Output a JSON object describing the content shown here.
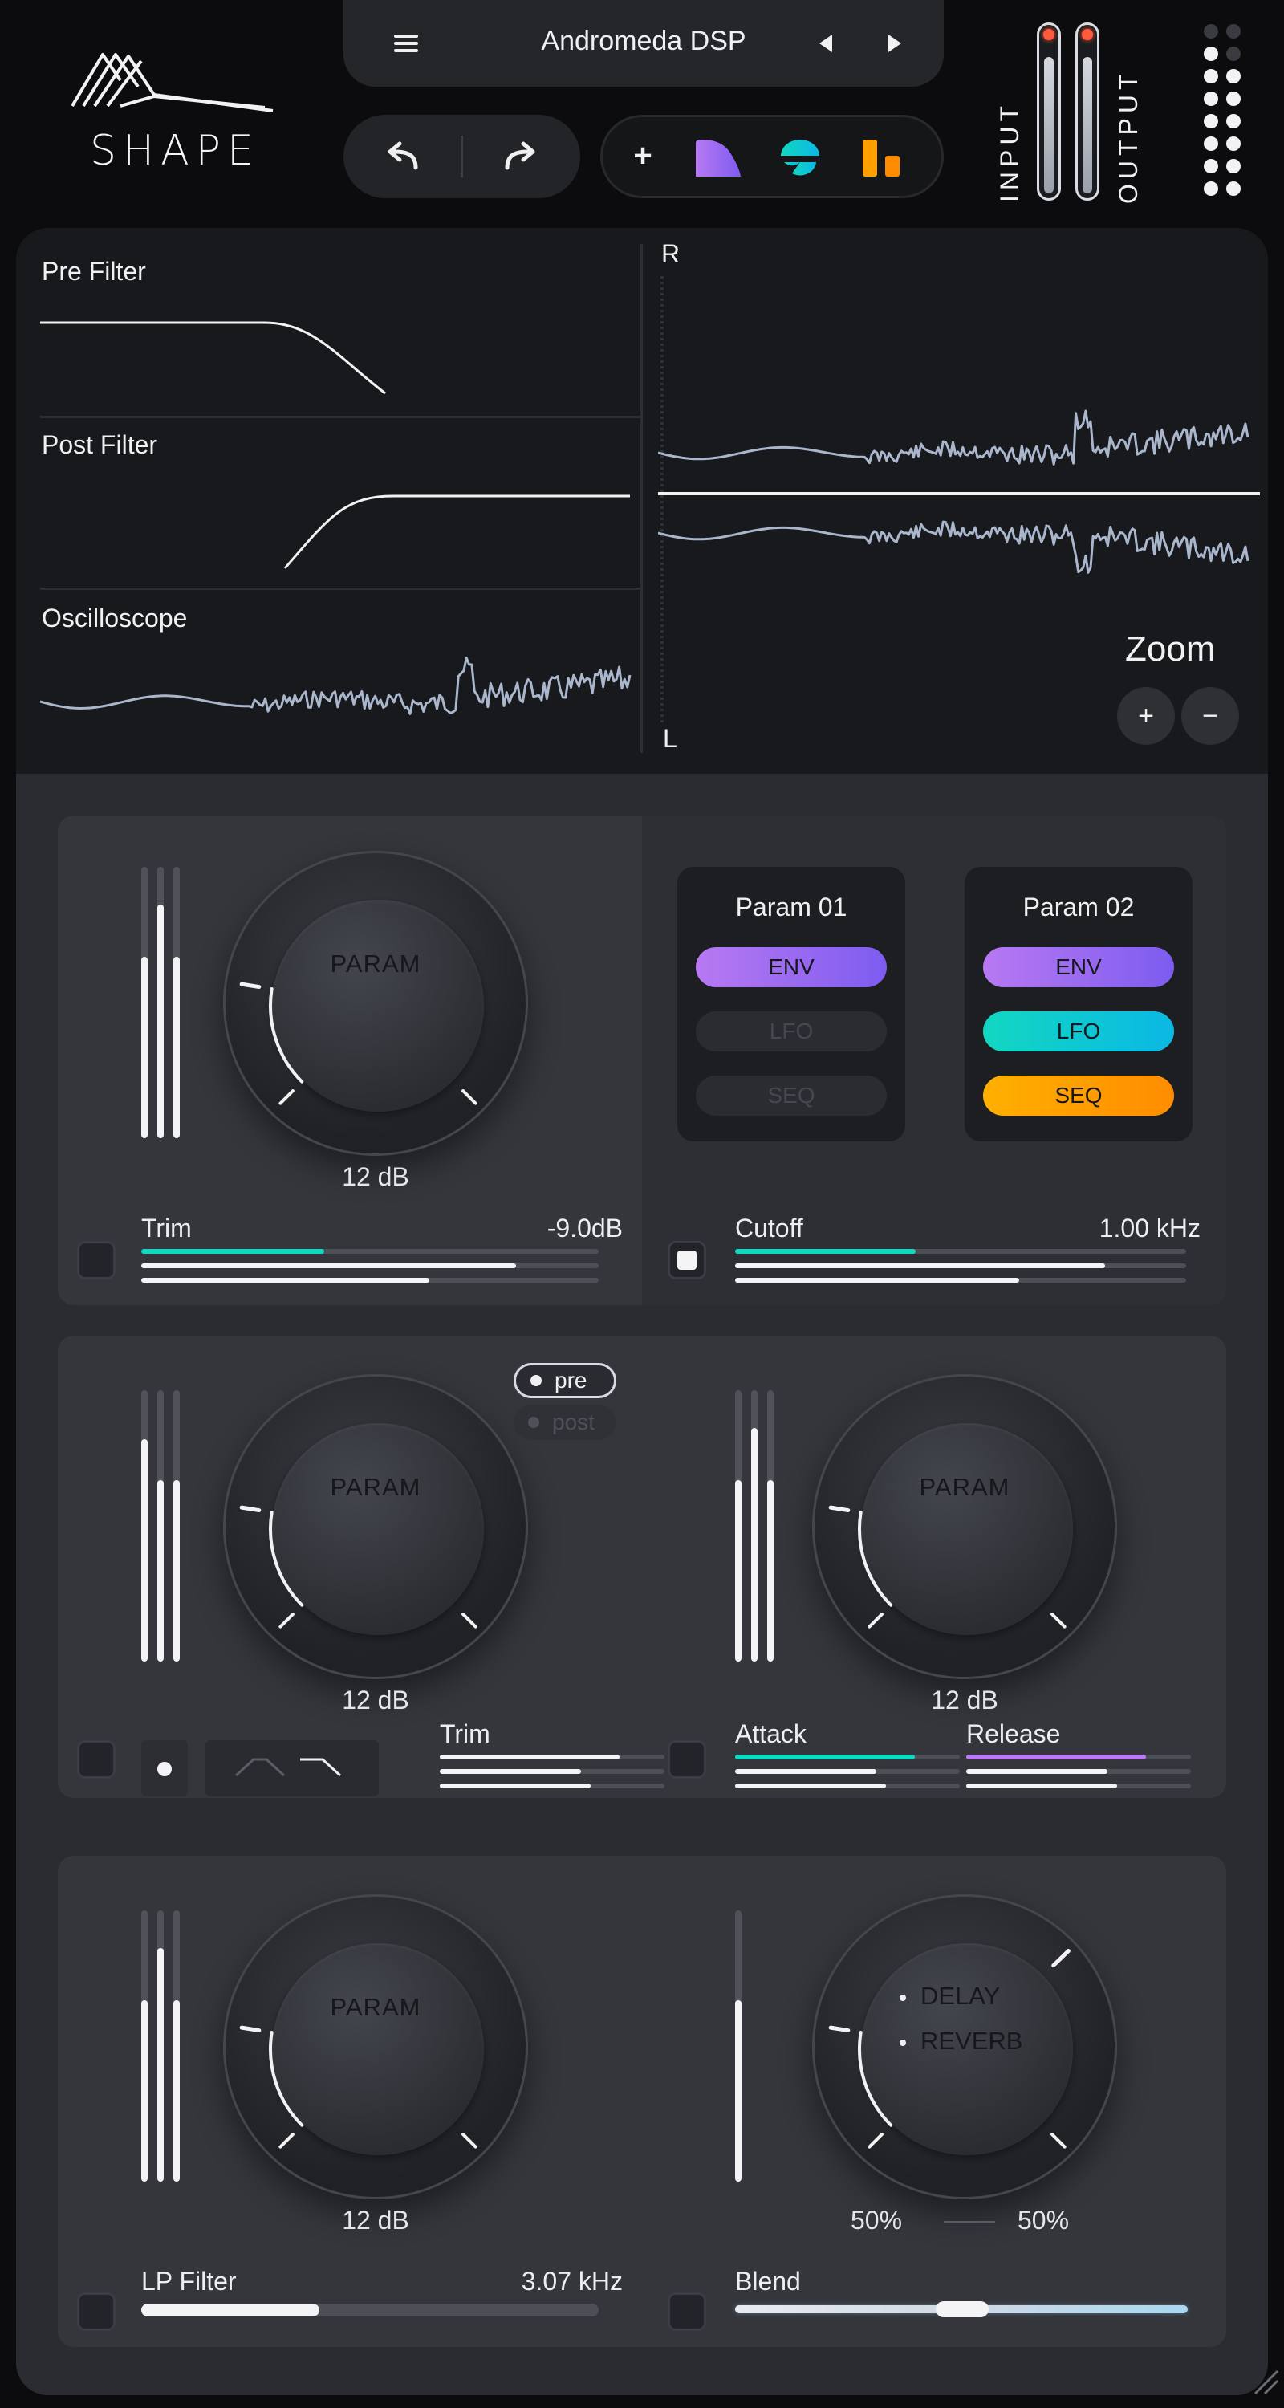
{
  "header": {
    "logo_text": "SHAPE",
    "preset_name": "Andromeda DSP",
    "input_label": "INPUT",
    "output_label": "OUTPUT",
    "input_level": 0.82,
    "output_level": 0.82,
    "tools": {
      "add": "+"
    }
  },
  "visualizer": {
    "pre_filter_label": "Pre Filter",
    "post_filter_label": "Post Filter",
    "oscilloscope_label": "Oscilloscope",
    "right_channel_label": "R",
    "left_channel_label": "L",
    "zoom_label": "Zoom",
    "zoom_in": "+",
    "zoom_out": "−"
  },
  "section1": {
    "knob": {
      "text": "PARAM",
      "value": "12 dB",
      "level": 0.2
    },
    "meter_levels": [
      0.67,
      0.86,
      0.67
    ],
    "trim": {
      "label": "Trim",
      "value": "-9.0dB",
      "levels": [
        0.4,
        0.82,
        0.63
      ]
    },
    "params": [
      {
        "title": "Param 01",
        "env": "ENV",
        "lfo": "LFO",
        "seq": "SEQ",
        "env_on": true,
        "lfo_on": false,
        "seq_on": false
      },
      {
        "title": "Param 02",
        "env": "ENV",
        "lfo": "LFO",
        "seq": "SEQ",
        "env_on": true,
        "lfo_on": true,
        "seq_on": true
      }
    ],
    "cutoff": {
      "label": "Cutoff",
      "value": "1.00 kHz",
      "levels": [
        0.4,
        0.82,
        0.63
      ],
      "checked": true
    }
  },
  "section2": {
    "knob_left": {
      "text": "PARAM",
      "value": "12 dB",
      "level": 0.2
    },
    "knob_right": {
      "text": "PARAM",
      "value": "12 dB",
      "level": 0.2
    },
    "meter_left_levels": [
      0.82,
      0.67,
      0.67
    ],
    "meter_right_levels": [
      0.67,
      0.86,
      0.67
    ],
    "pre_label": "pre",
    "post_label": "post",
    "trim": {
      "label": "Trim",
      "levels": [
        0.8,
        0.63,
        0.67
      ]
    },
    "attack": {
      "label": "Attack",
      "levels": [
        0.8,
        0.63,
        0.67
      ]
    },
    "release": {
      "label": "Release",
      "levels": [
        0.8,
        0.63,
        0.67
      ]
    }
  },
  "section3": {
    "knob_left": {
      "text": "PARAM",
      "value": "12 dB",
      "level": 0.2
    },
    "meter_left_levels": [
      0.67,
      0.86,
      0.67
    ],
    "meter_right_level": 0.67,
    "mix_knob": {
      "option1": "DELAY",
      "option2": "REVERB",
      "left_value": "50%",
      "right_value": "50%"
    },
    "lp_filter": {
      "label": "LP Filter",
      "value": "3.07 kHz",
      "level": 0.39
    },
    "blend": {
      "label": "Blend",
      "position": 0.5
    }
  },
  "colors": {
    "accent_teal": "#12d7c1",
    "accent_purple": "#b879f2",
    "accent_orange": "#ffa000",
    "led": "#ff5a3c"
  }
}
